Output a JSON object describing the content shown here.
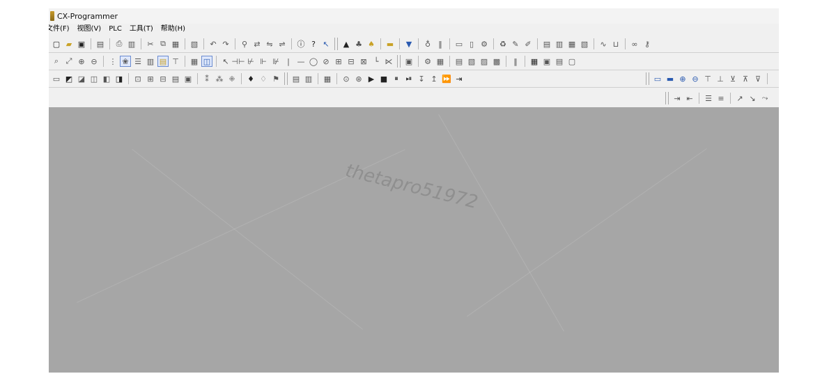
{
  "window": {
    "title": "CX-Programmer"
  },
  "menu": [
    {
      "label": "文件(F)"
    },
    {
      "label": "视图(V)"
    },
    {
      "label": "PLC"
    },
    {
      "label": "工具(T)"
    },
    {
      "label": "帮助(H)"
    }
  ],
  "watermark": "thetapro51972",
  "colors": {
    "workspace": "#a6a6a6",
    "chrome": "#f0f0f0",
    "accent": "#2a5ab0"
  }
}
